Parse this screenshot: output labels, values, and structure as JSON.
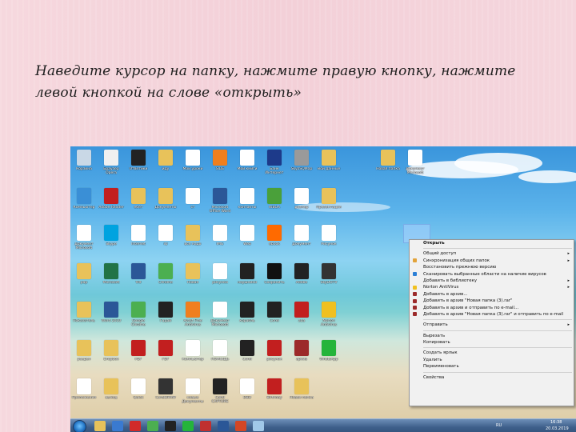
{
  "instruction": "Наведите курсор на папку, нажмите правую кнопку, нажмите левой кнопкой на слове «открыть»",
  "context_menu": {
    "items": [
      {
        "label": "Открыть",
        "bold": true
      },
      {
        "sep": true
      },
      {
        "label": "Общий доступ",
        "submenu": true
      },
      {
        "label": "Синхронизация общих папок",
        "submenu": true,
        "icon_color": "#e2a33a"
      },
      {
        "label": "Восстановить прежнюю версию"
      },
      {
        "label": "Сканировать выбранные области на наличие вирусов",
        "icon_color": "#2b7fd6"
      },
      {
        "label": "Добавить в библиотеку",
        "submenu": true
      },
      {
        "label": "Norton AntiVirus",
        "submenu": true,
        "icon_color": "#f0c020"
      },
      {
        "label": "Добавить в архив...",
        "icon_color": "#9c2a2a"
      },
      {
        "label": "Добавить в архив \"Новая папка (3).rar\"",
        "icon_color": "#9c2a2a"
      },
      {
        "label": "Добавить в архив и отправить по e-mail...",
        "icon_color": "#9c2a2a"
      },
      {
        "label": "Добавить в архив \"Новая папка (3).rar\" и отправить по e-mail",
        "icon_color": "#9c2a2a"
      },
      {
        "sep": true
      },
      {
        "label": "Отправить",
        "submenu": true
      },
      {
        "sep": true
      },
      {
        "label": "Вырезать"
      },
      {
        "label": "Копировать"
      },
      {
        "sep": true
      },
      {
        "label": "Создать ярлык"
      },
      {
        "label": "Удалить"
      },
      {
        "label": "Переименовать"
      },
      {
        "sep": true
      },
      {
        "label": "Свойства"
      }
    ]
  },
  "taskbar": {
    "language": "RU",
    "time": "16:38",
    "date": "20.03.2019",
    "apps": [
      {
        "name": "explorer",
        "color": "#e8c25a"
      },
      {
        "name": "media",
        "color": "#3a7ad0"
      },
      {
        "name": "opera",
        "color": "#d12a2a"
      },
      {
        "name": "chrome",
        "color": "#4caf50"
      },
      {
        "name": "capture",
        "color": "#222222"
      },
      {
        "name": "whatsapp",
        "color": "#25b43b"
      },
      {
        "name": "player",
        "color": "#c03030"
      },
      {
        "name": "word",
        "color": "#2b5797"
      },
      {
        "name": "powerpoint",
        "color": "#d24726"
      },
      {
        "name": "picture",
        "color": "#a0c8e8"
      }
    ]
  },
  "desktop_icons": [
    {
      "label": "Корзина",
      "color": "#c9d8e6"
    },
    {
      "label": "Браузер Opera",
      "color": "#f0f0f0"
    },
    {
      "label": "Ответики",
      "color": "#222222"
    },
    {
      "label": "иду",
      "color": "#e8c25a"
    },
    {
      "label": "Мои уроки",
      "color": "#ffffff"
    },
    {
      "label": "SIDE",
      "color": "#f07f1e"
    },
    {
      "label": "Мои книги",
      "color": "#ffffff"
    },
    {
      "label": "Банк Интернет",
      "color": "#1d3a8a"
    },
    {
      "label": "SkyoSQMap",
      "color": "#9a9a9a"
    },
    {
      "label": "мои данные",
      "color": "#e8c25a"
    },
    {
      "label": "Новая папка",
      "color": "#e8c25a"
    },
    {
      "label": "Документ Microsoft",
      "color": "#ffffff"
    },
    {
      "label": "Компьютер",
      "color": "#3a8fd6"
    },
    {
      "label": "Adobe Reader",
      "color": "#c21f1f"
    },
    {
      "label": "ебет",
      "color": "#e8c25a"
    },
    {
      "label": "Документы",
      "color": "#e8c25a"
    },
    {
      "label": "ст",
      "color": "#ffffff"
    },
    {
      "label": "Microsoft Office Word",
      "color": "#2b5797"
    },
    {
      "label": "контакты",
      "color": "#ffffff"
    },
    {
      "label": "WBOA",
      "color": "#4aa03a"
    },
    {
      "label": "размер",
      "color": "#ffffff"
    },
    {
      "label": "Презентация",
      "color": "#e8c25a"
    },
    {
      "label": "Документ Microsoft",
      "color": "#ffffff"
    },
    {
      "label": "Skype",
      "color": "#00a3e0"
    },
    {
      "label": "Internet",
      "color": "#ffffff"
    },
    {
      "label": "iQ",
      "color": "#ffffff"
    },
    {
      "label": "все надо",
      "color": "#e8c25a"
    },
    {
      "label": "IMG",
      "color": "#ffffff"
    },
    {
      "label": "Web",
      "color": "#ffffff"
    },
    {
      "label": "ebook",
      "color": "#ff6a00"
    },
    {
      "label": "Документ",
      "color": "#ffffff"
    },
    {
      "label": "Рисунок",
      "color": "#ffffff"
    },
    {
      "label": "рар",
      "color": "#e8c25a"
    },
    {
      "label": "Microsoft",
      "color": "#217346"
    },
    {
      "label": "Vid",
      "color": "#2b5797"
    },
    {
      "label": "Chrome",
      "color": "#4caf50"
    },
    {
      "label": "Новая",
      "color": "#e8c25a"
    },
    {
      "label": "рисунки",
      "color": "#ffffff"
    },
    {
      "label": "наушники",
      "color": "#222222"
    },
    {
      "label": "Сохранить",
      "color": "#111111"
    },
    {
      "label": "Adobe",
      "color": "#222222"
    },
    {
      "label": "SkyDOTV",
      "color": "#333333"
    },
    {
      "label": "Показатель",
      "color": "#e8c25a"
    },
    {
      "label": "Word 2010",
      "color": "#2b5797"
    },
    {
      "label": "Google Chrome",
      "color": "#4caf50"
    },
    {
      "label": "Гадай",
      "color": "#222222"
    },
    {
      "label": "Avast Free Antivirus",
      "color": "#f07f1e"
    },
    {
      "label": "Документ Microsoft",
      "color": "#ffffff"
    },
    {
      "label": "корабль",
      "color": "#222222"
    },
    {
      "label": "Corel",
      "color": "#222222"
    },
    {
      "label": "ааа",
      "color": "#c21f1f"
    },
    {
      "label": "Norton Antivirus",
      "color": "#f0c020"
    },
    {
      "label": "раздел",
      "color": "#e8c25a"
    },
    {
      "label": "Dropbox",
      "color": "#e8c25a"
    },
    {
      "label": "PDF",
      "color": "#c21f1f"
    },
    {
      "label": "FDF",
      "color": "#c21f1f"
    },
    {
      "label": "Компьютер",
      "color": "#ffffff"
    },
    {
      "label": "ПОМОЩЬ",
      "color": "#ffffff"
    },
    {
      "label": "Corel",
      "color": "#222222"
    },
    {
      "label": "рисунок",
      "color": "#c21f1f"
    },
    {
      "label": "архив",
      "color": "#9c2a2a"
    },
    {
      "label": "WhatsApp",
      "color": "#25b43b"
    },
    {
      "label": "Приложения",
      "color": "#ffffff"
    },
    {
      "label": "выход",
      "color": "#e8c25a"
    },
    {
      "label": "Quick",
      "color": "#ffffff"
    },
    {
      "label": "CorelDRAW",
      "color": "#333333"
    },
    {
      "label": "новые Документы",
      "color": "#ffffff"
    },
    {
      "label": "Corel CAPTURE",
      "color": "#222222"
    },
    {
      "label": "DBD",
      "color": "#ffffff"
    },
    {
      "label": "Birthday",
      "color": "#c21f1f"
    },
    {
      "label": "Новая папка",
      "color": "#e8c25a"
    }
  ]
}
